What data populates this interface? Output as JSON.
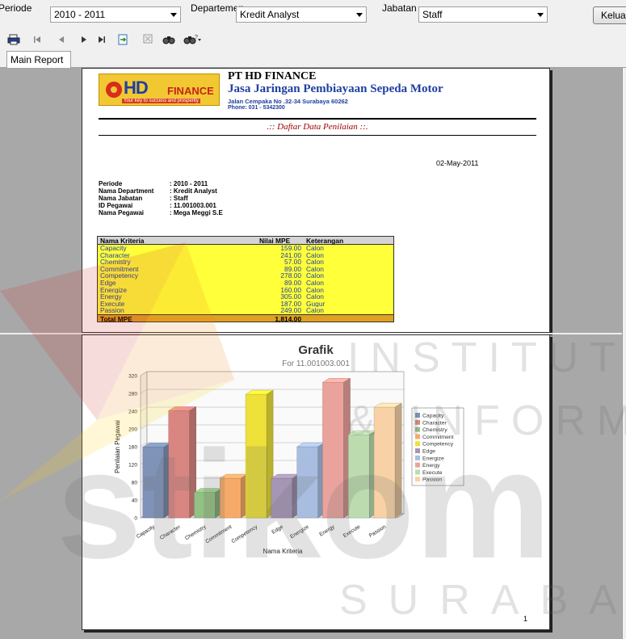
{
  "filters": {
    "periode_label": "Periode",
    "periode_value": "2010 - 2011",
    "departemen_label": "Departemen",
    "departemen_value": "Kredit Analyst",
    "jabatan_label": "Jabatan",
    "jabatan_value": "Staff",
    "exit_label": "Keluar"
  },
  "toolbar": {
    "icons": [
      "print-icon",
      "first-page-icon",
      "prev-page-icon",
      "next-page-icon",
      "last-page-icon",
      "export-icon",
      "close-icon",
      "find-icon",
      "find-options-icon"
    ]
  },
  "tabs": {
    "main": "Main Report"
  },
  "report": {
    "company": "PT HD FINANCE",
    "motto": "Jasa Jaringan Pembiayaan Sepeda Motor",
    "address": "Jalan Cempaka No .32-34  Surabaya 60262",
    "phone": "Phone: 031 - 5342300",
    "logo_main": "HD",
    "logo_sub": "FINANCE",
    "logo_tagline": "Your key to success and prosperity",
    "title": ".:: Daftar Data Penilaian ::.",
    "date": "02-May-2011",
    "info": [
      {
        "key": "Periode",
        "value": ": 2010 - 2011"
      },
      {
        "key": "Nama Department",
        "value": ": Kredit Analyst"
      },
      {
        "key": "Nama Jabatan",
        "value": ": Staff"
      },
      {
        "key": "ID Pegawai",
        "value": ": 11.001003.001"
      },
      {
        "key": "Nama Pegawai",
        "value": ":  Mega Meggi S.E"
      }
    ],
    "table": {
      "headers": [
        "Nama Kriteria",
        "Nilai MPE",
        "Keterangan"
      ],
      "rows": [
        [
          "Capacity",
          "159.00",
          "Calon"
        ],
        [
          "Character",
          "241.00",
          "Calon"
        ],
        [
          "Chemistry",
          "57.00",
          "Calon"
        ],
        [
          "Commitment",
          "89.00",
          "Calon"
        ],
        [
          "Competency",
          "278.00",
          "Calon"
        ],
        [
          "Edge",
          "89.00",
          "Calon"
        ],
        [
          "Energize",
          "160.00",
          "Calon"
        ],
        [
          "Energy",
          "305.00",
          "Calon"
        ],
        [
          "Execute",
          "187.00",
          "Gugur"
        ],
        [
          "Passion",
          "249.00",
          "Calon"
        ]
      ],
      "total_label": "Total MPE",
      "total_value": "1,814.00"
    },
    "page_number": "1"
  },
  "chart_data": {
    "type": "bar",
    "title": "Grafik",
    "subtitle": "For 11.001003.001",
    "xlabel": "Nama Kriteria",
    "ylabel": "Penilaian Pegawai",
    "ylim": [
      0,
      320
    ],
    "yticks": [
      0,
      40,
      80,
      120,
      160,
      200,
      240,
      280,
      320
    ],
    "grid": true,
    "legend": "right",
    "categories": [
      "Capacity",
      "Character",
      "Chemistry",
      "Commitment",
      "Competency",
      "Edge",
      "Energize",
      "Energy",
      "Execute",
      "Passion"
    ],
    "values": [
      159,
      241,
      57,
      89,
      278,
      89,
      160,
      305,
      187,
      249
    ],
    "colors": [
      "#7f93b8",
      "#d98682",
      "#93c083",
      "#f6aa6a",
      "#ede13a",
      "#a696b6",
      "#a9bde0",
      "#eaa39c",
      "#bcdcb0",
      "#f8d2a6"
    ]
  },
  "watermark": {
    "line1": "INSTITUT BISNIS",
    "line2": "& INFORMATIKA",
    "brand": "stikom",
    "city": "SURABAYA"
  }
}
